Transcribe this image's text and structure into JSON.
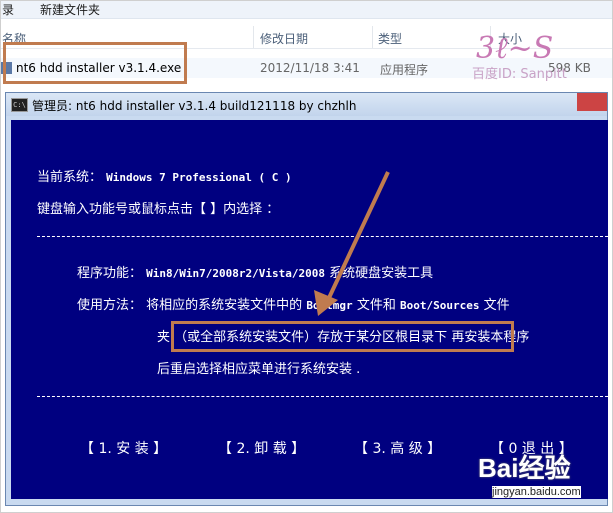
{
  "explorer": {
    "toolbar": {
      "left_item": "录",
      "new_folder": "新建文件夹"
    },
    "columns": {
      "name": "名称",
      "modified": "修改日期",
      "type": "类型",
      "size": "大小"
    },
    "rows": [
      {
        "name": "nt6 hdd installer v3.1.4.exe",
        "modified": "2012/11/18 3:41",
        "type": "应用程序",
        "size": "598 KB"
      }
    ]
  },
  "watermark": {
    "logo": "3ℓ~S",
    "caption": "百度ID: Sanpitt"
  },
  "cmd_window": {
    "title": "管理员:  nt6 hdd installer v3.1.4 build121118 by chzhlh",
    "icon_text": "C:\\",
    "lines": {
      "current_system_label": "当前系统：",
      "current_system_value": "Windows 7 Professional  ( C )",
      "prompt": "键盘输入功能号或鼠标点击【 】内选择 ：",
      "func_label": "程序功能：",
      "func_value_mono": "Win8/Win7/2008r2/Vista/2008",
      "func_value_text": "系统硬盘安装工具",
      "usage_label": "使用方法：",
      "usage_1a": "将相应的系统安装文件中的",
      "usage_1b": "Bootmgr",
      "usage_1c": "文件和",
      "usage_1d": "Boot/Sources",
      "usage_1e": "文件",
      "usage_2a": "夹",
      "usage_2b": "（或全部系统安装文件）存放于某分区根目录下",
      "usage_2c": "再安装本程序",
      "usage_3": "后重启选择相应菜单进行系统安装 ."
    },
    "menu": {
      "install": "【 1. 安 装 】",
      "uninstall": "【 2. 卸 载 】",
      "advanced": "【 3. 高 级 】",
      "exit": "【 0  退 出 】"
    }
  },
  "baidu_watermark": {
    "logo": "Bai经验",
    "url": "jingyan.baidu.com"
  },
  "colors": {
    "console_bg": "#000080",
    "annotation": "#c07b4f",
    "title_bar": "#c9daf0"
  }
}
